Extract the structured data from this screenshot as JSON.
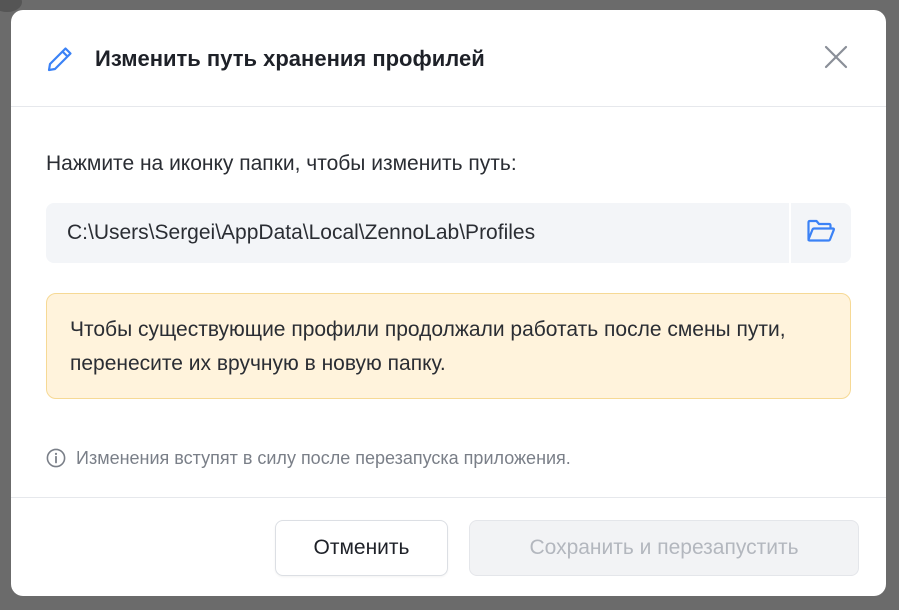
{
  "dialog": {
    "title": "Изменить путь хранения профилей",
    "title_icon": "pencil-icon",
    "close_icon": "close-icon"
  },
  "body": {
    "instruction": "Нажмите на иконку папки, чтобы изменить путь:",
    "path_value": "C:\\Users\\Sergei\\AppData\\Local\\ZennoLab\\Profiles",
    "folder_icon": "folder-open-icon",
    "warning": "Чтобы существующие профили продолжали работать после смены пути, перенесите их вручную в новую папку.",
    "note_icon": "info-icon",
    "note": "Изменения вступят в силу после перезапуска приложения."
  },
  "footer": {
    "cancel_label": "Отменить",
    "save_label": "Сохранить и перезапустить",
    "save_disabled": true
  },
  "colors": {
    "accent": "#3b82f6",
    "warning_bg": "#fff3dc",
    "warning_border": "#f6d995",
    "muted_text": "#7a7f88",
    "disabled_text": "#b3b7be"
  }
}
